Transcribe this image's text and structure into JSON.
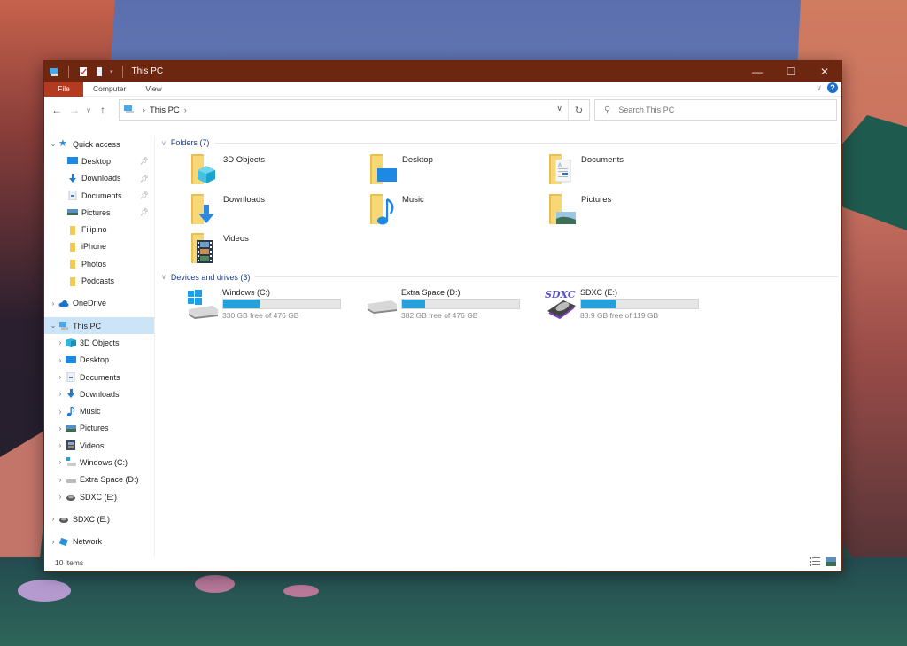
{
  "window": {
    "title": "This PC",
    "controls": {
      "minimize": "—",
      "maximize": "☐",
      "close": "✕"
    }
  },
  "ribbon": {
    "tabs": [
      "File",
      "Computer",
      "View"
    ],
    "help": "?",
    "expand": "∨"
  },
  "navbar": {
    "back": "←",
    "forward": "→",
    "recent": "∨",
    "up": "↑",
    "path": "This PC",
    "path_sep": "›",
    "dropdown": "∨",
    "refresh": "↻",
    "search_icon": "⚲",
    "search_placeholder": "Search This PC"
  },
  "sidebar": {
    "quick_access": {
      "label": "Quick access",
      "items": [
        {
          "label": "Desktop",
          "icon": "desktop-icon",
          "pinned": true
        },
        {
          "label": "Downloads",
          "icon": "downloads-icon",
          "pinned": true
        },
        {
          "label": "Documents",
          "icon": "documents-icon",
          "pinned": true
        },
        {
          "label": "Pictures",
          "icon": "pictures-icon",
          "pinned": true
        },
        {
          "label": "Filipino",
          "icon": "folder-icon",
          "pinned": false
        },
        {
          "label": "iPhone",
          "icon": "folder-icon",
          "pinned": false
        },
        {
          "label": "Photos",
          "icon": "folder-icon",
          "pinned": false
        },
        {
          "label": "Podcasts",
          "icon": "folder-icon",
          "pinned": false
        }
      ]
    },
    "onedrive": "OneDrive",
    "this_pc": {
      "label": "This PC",
      "items": [
        {
          "label": "3D Objects",
          "icon": "3d-objects-icon"
        },
        {
          "label": "Desktop",
          "icon": "desktop-icon"
        },
        {
          "label": "Documents",
          "icon": "documents-icon"
        },
        {
          "label": "Downloads",
          "icon": "downloads-icon"
        },
        {
          "label": "Music",
          "icon": "music-icon"
        },
        {
          "label": "Pictures",
          "icon": "pictures-icon"
        },
        {
          "label": "Videos",
          "icon": "videos-icon"
        },
        {
          "label": "Windows (C:)",
          "icon": "windows-drive-icon"
        },
        {
          "label": "Extra Space (D:)",
          "icon": "drive-icon"
        },
        {
          "label": "SDXC (E:)",
          "icon": "sdxc-drive-icon"
        }
      ]
    },
    "sdxc": "SDXC (E:)",
    "network": "Network"
  },
  "content": {
    "folders_header": "Folders (7)",
    "folders": [
      {
        "name": "3D Objects",
        "overlay": "3d"
      },
      {
        "name": "Desktop",
        "overlay": "desktop"
      },
      {
        "name": "Documents",
        "overlay": "documents"
      },
      {
        "name": "Downloads",
        "overlay": "downloads"
      },
      {
        "name": "Music",
        "overlay": "music"
      },
      {
        "name": "Pictures",
        "overlay": "pictures"
      },
      {
        "name": "Videos",
        "overlay": "videos"
      }
    ],
    "drives_header": "Devices and drives (3)",
    "drives": [
      {
        "name": "Windows (C:)",
        "free": "330 GB free of 476 GB",
        "used_fraction": 0.307,
        "type": "windows"
      },
      {
        "name": "Extra Space (D:)",
        "free": "382 GB free of 476 GB",
        "used_fraction": 0.197,
        "type": "hdd"
      },
      {
        "name": "SDXC (E:)",
        "free": "83.9 GB free of 119 GB",
        "used_fraction": 0.295,
        "type": "sdxc",
        "badge": "SDXC"
      }
    ]
  },
  "status": {
    "items": "10 items"
  },
  "colors": {
    "titlebar": "#6d2610",
    "file_tab": "#b23b22",
    "accent": "#26a0da",
    "selected": "#cce4f7"
  }
}
